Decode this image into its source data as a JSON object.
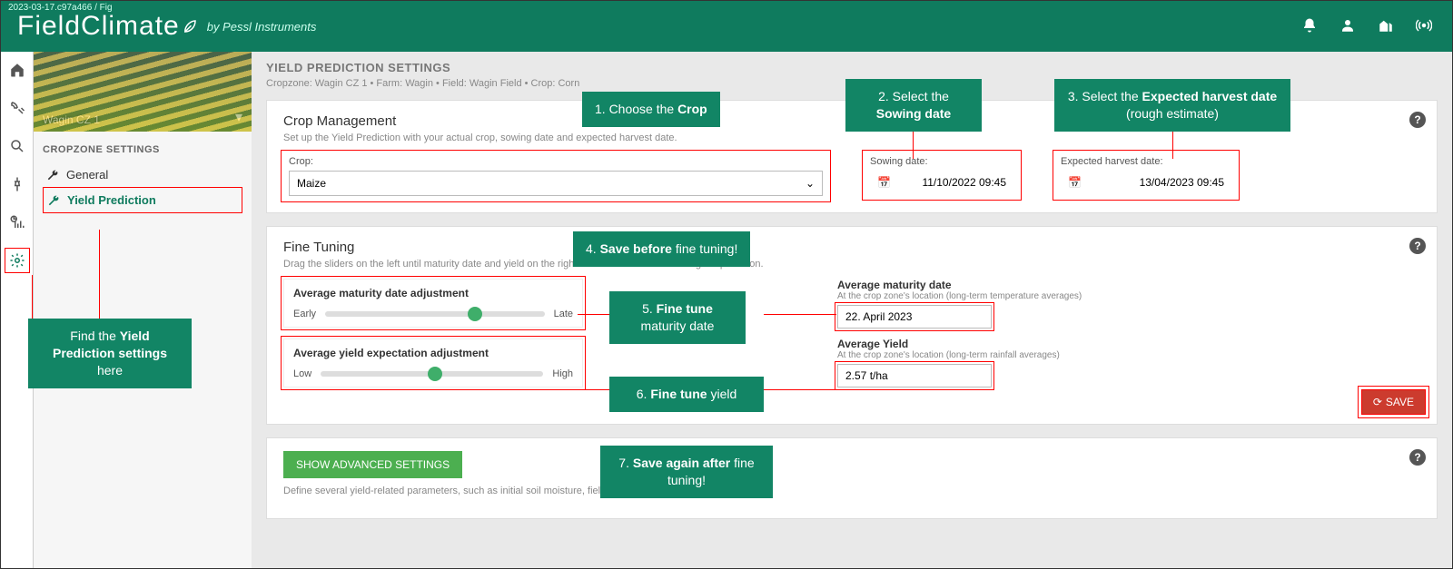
{
  "top": {
    "version": "2023-03-17.c97a466 / Fig",
    "brand_main": "FieldClimate",
    "brand_sub": "by Pessl Instruments"
  },
  "sidebar": {
    "hero_caption": "Wagin CZ 1",
    "section_title": "CROPZONE SETTINGS",
    "items": [
      {
        "label": "General"
      },
      {
        "label": "Yield Prediction"
      }
    ]
  },
  "page": {
    "title": "YIELD PREDICTION SETTINGS",
    "breadcrumb": "Cropzone: Wagin CZ 1 • Farm: Wagin • Field: Wagin Field • Crop: Corn"
  },
  "crop_mgmt": {
    "heading": "Crop Management",
    "sub": "Set up the Yield Prediction with your actual crop, sowing date and expected harvest date.",
    "crop_label": "Crop:",
    "crop_value": "Maize",
    "sowing_label": "Sowing date:",
    "sowing_value": "11/10/2022 09:45",
    "harvest_label": "Expected harvest date:",
    "harvest_value": "13/04/2023 09:45"
  },
  "fine": {
    "heading": "Fine Tuning",
    "sub": "Drag the sliders on the left until maturity date and yield on the right match the location's average expectation.",
    "slider1_title": "Average maturity date adjustment",
    "slider1_left": "Early",
    "slider1_right": "Late",
    "slider2_title": "Average yield expectation adjustment",
    "slider2_left": "Low",
    "slider2_right": "High",
    "out1_label": "Average maturity date",
    "out1_sub": "At the crop zone's location (long-term temperature averages)",
    "out1_value": "22. April 2023",
    "out2_label": "Average Yield",
    "out2_sub": "At the crop zone's location (long-term rainfall averages)",
    "out2_value": "2.57 t/ha",
    "save_label": "SAVE"
  },
  "adv": {
    "button": "SHOW ADVANCED SETTINGS",
    "sub": "Define several yield-related parameters, such as initial soil moisture, field capacity and wilting point."
  },
  "callouts": {
    "find": "Find the <b>Yield Prediction settings</b> here",
    "c1": "1. Choose the <b>Crop</b>",
    "c2": "2. Select the <b>Sowing date</b>",
    "c3": "3. Select the <b>Expected harvest date</b> (rough estimate)",
    "c4": "4. <b>Save before</b> fine tuning!",
    "c5": "5. <b>Fine tune</b> maturity date",
    "c6": "6. <b>Fine tune</b> yield",
    "c7": "7. <b>Save again after</b> fine tuning!"
  }
}
